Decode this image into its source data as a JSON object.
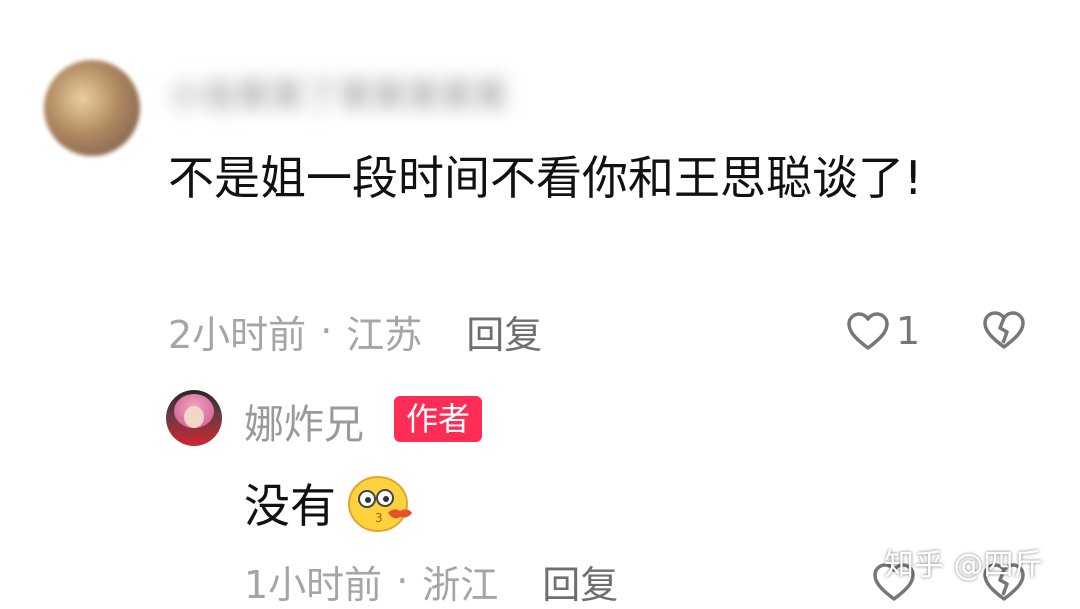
{
  "comment": {
    "username": "小虫某某了某某某某某",
    "text": "不是姐一段时间不看你和王思聪谈了!",
    "time": "2小时前",
    "separator": "·",
    "location": "江苏",
    "reply_label": "回复",
    "like_count": "1"
  },
  "reply": {
    "name": "娜炸兄",
    "badge": "作者",
    "text": "没有",
    "time": "1小时前",
    "separator": "·",
    "location": "浙江",
    "reply_label": "回复"
  },
  "watermark": "知乎 @四斤",
  "colors": {
    "badge_bg": "#ff2d55",
    "meta_text": "#a5a5a5",
    "reply_btn": "#6f6f6f"
  },
  "icons": [
    "heart-icon",
    "broken-heart-icon",
    "emoji-icon"
  ]
}
